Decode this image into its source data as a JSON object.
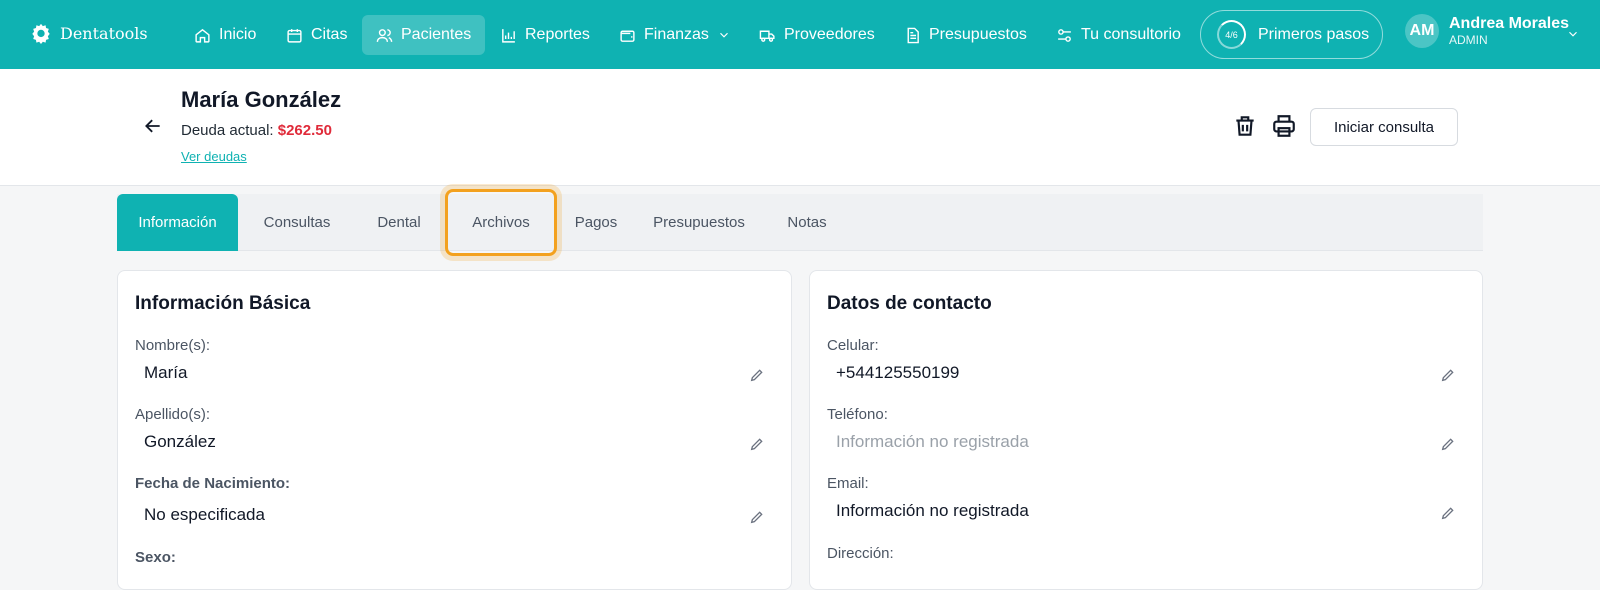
{
  "brand": {
    "name": "Dentatools",
    "icon": "tooth-gear-icon"
  },
  "nav": {
    "items": [
      {
        "label": "Inicio",
        "icon": "home-icon"
      },
      {
        "label": "Citas",
        "icon": "calendar-icon"
      },
      {
        "label": "Pacientes",
        "icon": "users-icon",
        "active": true
      },
      {
        "label": "Reportes",
        "icon": "bar-chart-icon"
      },
      {
        "label": "Finanzas",
        "icon": "wallet-icon"
      },
      {
        "label": "Proveedores",
        "icon": "truck-icon"
      },
      {
        "label": "Presupuestos",
        "icon": "document-icon"
      },
      {
        "label": "Tu consultorio",
        "icon": "settings-sliders-icon"
      }
    ],
    "steps": {
      "progress": "4/6",
      "label": "Primeros pasos"
    },
    "user": {
      "initials": "AM",
      "name": "Andrea Morales",
      "role": "ADMIN"
    }
  },
  "patient": {
    "name": "María González",
    "debt_label": "Deuda actual:",
    "debt_value": "$262.50",
    "debt_link": "Ver deudas",
    "start_button": "Iniciar consulta"
  },
  "tabs": [
    "Información",
    "Consultas",
    "Dental",
    "Archivos",
    "Pagos",
    "Presupuestos",
    "Notas"
  ],
  "basic_info": {
    "title": "Información Básica",
    "fields": [
      {
        "label": "Nombre(s):",
        "value": "María"
      },
      {
        "label": "Apellido(s):",
        "value": "González"
      },
      {
        "label": "Fecha de Nacimiento:",
        "value": "No especificada"
      },
      {
        "label": "Sexo:"
      }
    ]
  },
  "contact_info": {
    "title": "Datos de contacto",
    "fields": [
      {
        "label": "Celular:",
        "value": "+544125550199"
      },
      {
        "label": "Teléfono:",
        "value": "Información no registrada"
      },
      {
        "label": "Email:",
        "value": "Información no registrada"
      },
      {
        "label": "Dirección:"
      }
    ]
  },
  "colors": {
    "accent": "#0fb2b2",
    "debt": "#e02b3a",
    "focus": "#f3a11e"
  }
}
